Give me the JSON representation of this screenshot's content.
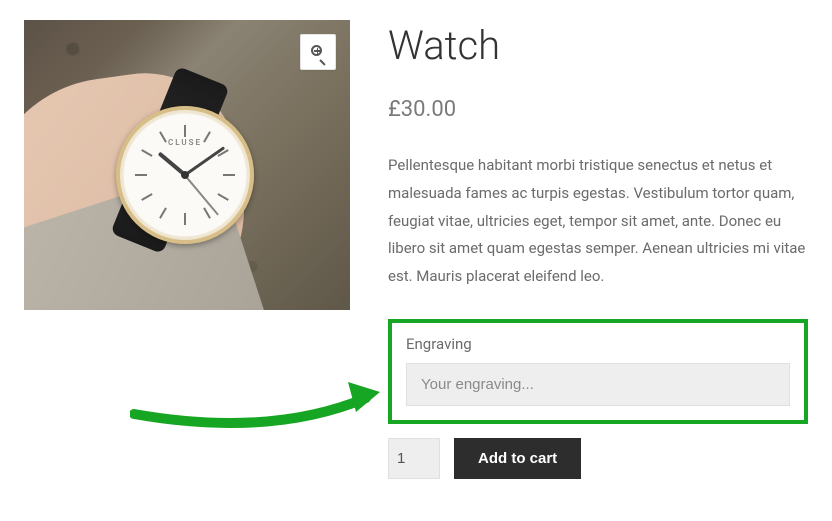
{
  "product": {
    "title": "Watch",
    "price": "£30.00",
    "description": "Pellentesque habitant morbi tristique senectus et netus et malesuada fames ac turpis egestas. Vestibulum tortor quam, feugiat vitae, ultricies eget, tempor sit amet, ante. Donec eu libero sit amet quam egestas semper. Aenean ultricies mi vitae est. Mauris placerat eleifend leo.",
    "image_brand": "CLUSE"
  },
  "engraving": {
    "label": "Engraving",
    "placeholder": "Your engraving..."
  },
  "cart": {
    "quantity": "1",
    "add_label": "Add to cart"
  },
  "callout": {
    "color": "#17a623"
  }
}
